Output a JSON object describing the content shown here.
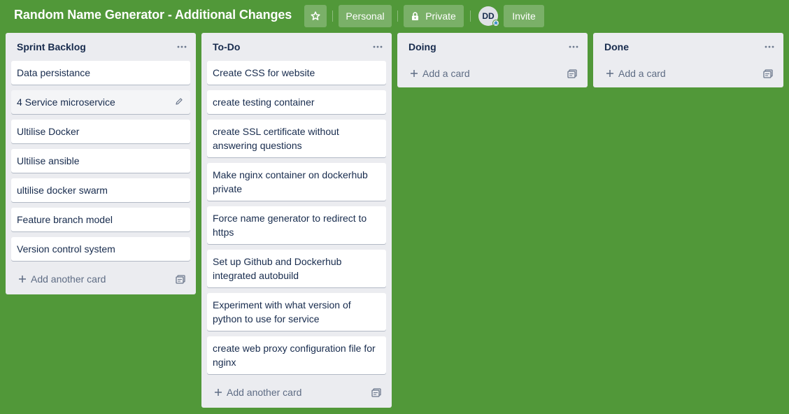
{
  "board": {
    "title": "Random Name Generator - Additional Changes",
    "personal_label": "Personal",
    "private_label": "Private",
    "avatar_initials": "DD",
    "invite_label": "Invite",
    "background_color": "#519839"
  },
  "lists": [
    {
      "title": "Sprint Backlog",
      "cards": [
        "Data persistance",
        "4 Service microservice",
        "Ultilise Docker",
        "Ultilise ansible",
        "ultilise docker swarm",
        "Feature branch model",
        "Version control system"
      ],
      "add_label": "Add another card"
    },
    {
      "title": "To-Do",
      "cards": [
        "Create CSS for website",
        "create testing container",
        "create SSL certificate without answering questions",
        "Make nginx container on dockerhub private",
        "Force name generator to redirect to https",
        "Set up Github and Dockerhub integrated autobuild",
        "Experiment with what version of python to use for service",
        "create web proxy configuration file for nginx"
      ],
      "add_label": "Add another card"
    },
    {
      "title": "Doing",
      "cards": [],
      "add_label": "Add a card"
    },
    {
      "title": "Done",
      "cards": [],
      "add_label": "Add a card"
    }
  ],
  "icons": {
    "star": "star-icon",
    "lock": "lock-icon",
    "list_menu": "more-icon",
    "edit": "pencil-icon",
    "add": "plus-icon",
    "template": "card-template-icon"
  }
}
